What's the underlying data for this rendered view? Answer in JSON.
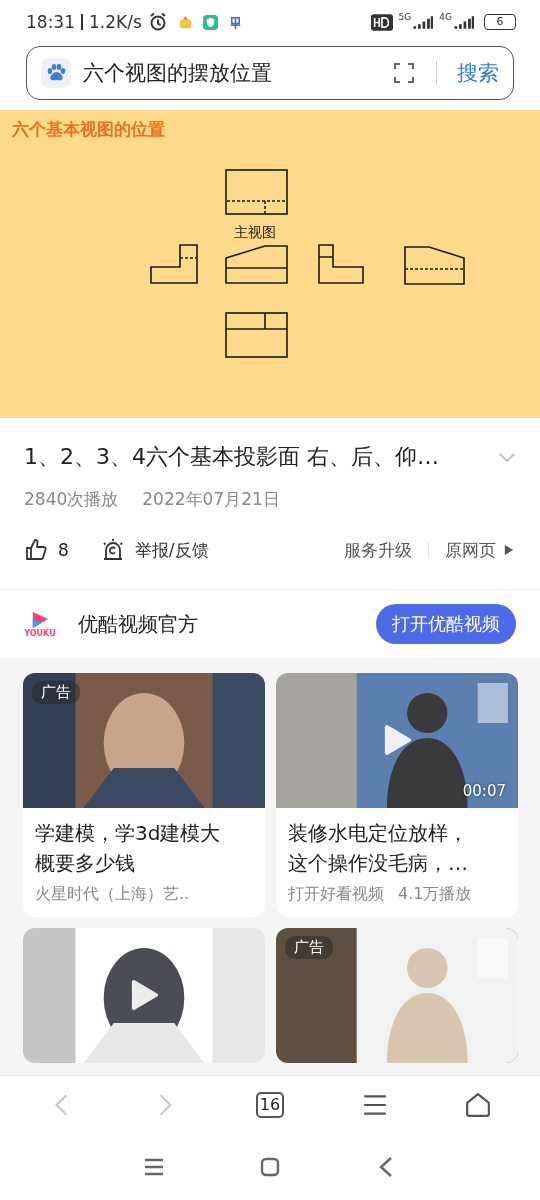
{
  "status_bar": {
    "time": "18:31",
    "speed": "1.2K/s",
    "network_1": "5G",
    "network_2": "4G",
    "battery": "6"
  },
  "search": {
    "value": "六个视图的摆放位置",
    "button": "搜索"
  },
  "video": {
    "slide_title": "六个基本视图的位置",
    "view_label": "主视图",
    "title": "1、2、3、4六个基本投影面 右、后、仰…",
    "views": "2840次播放",
    "date": "2022年07月21日"
  },
  "actions": {
    "likes": "8",
    "report": "举报/反馈",
    "upgrade": "服务升级",
    "original": "原网页"
  },
  "channel": {
    "logo_text": "YOUKU",
    "name": "优酷视频官方",
    "button": "打开优酷视频"
  },
  "cards": [
    {
      "badge": "广告",
      "play": false,
      "title": "学建模，学3d建模大概要多少钱",
      "source": "火星时代（上海）艺.."
    },
    {
      "play": true,
      "duration": "00:07",
      "title": "装修水电定位放样，这个操作没毛病，…",
      "source": "打开好看视频",
      "plays": "4.1万播放"
    },
    {
      "play": true
    },
    {
      "badge": "广告",
      "play": false
    }
  ],
  "toolbar": {
    "back_disabled": true,
    "forward_disabled": true,
    "tab_count": "16"
  }
}
